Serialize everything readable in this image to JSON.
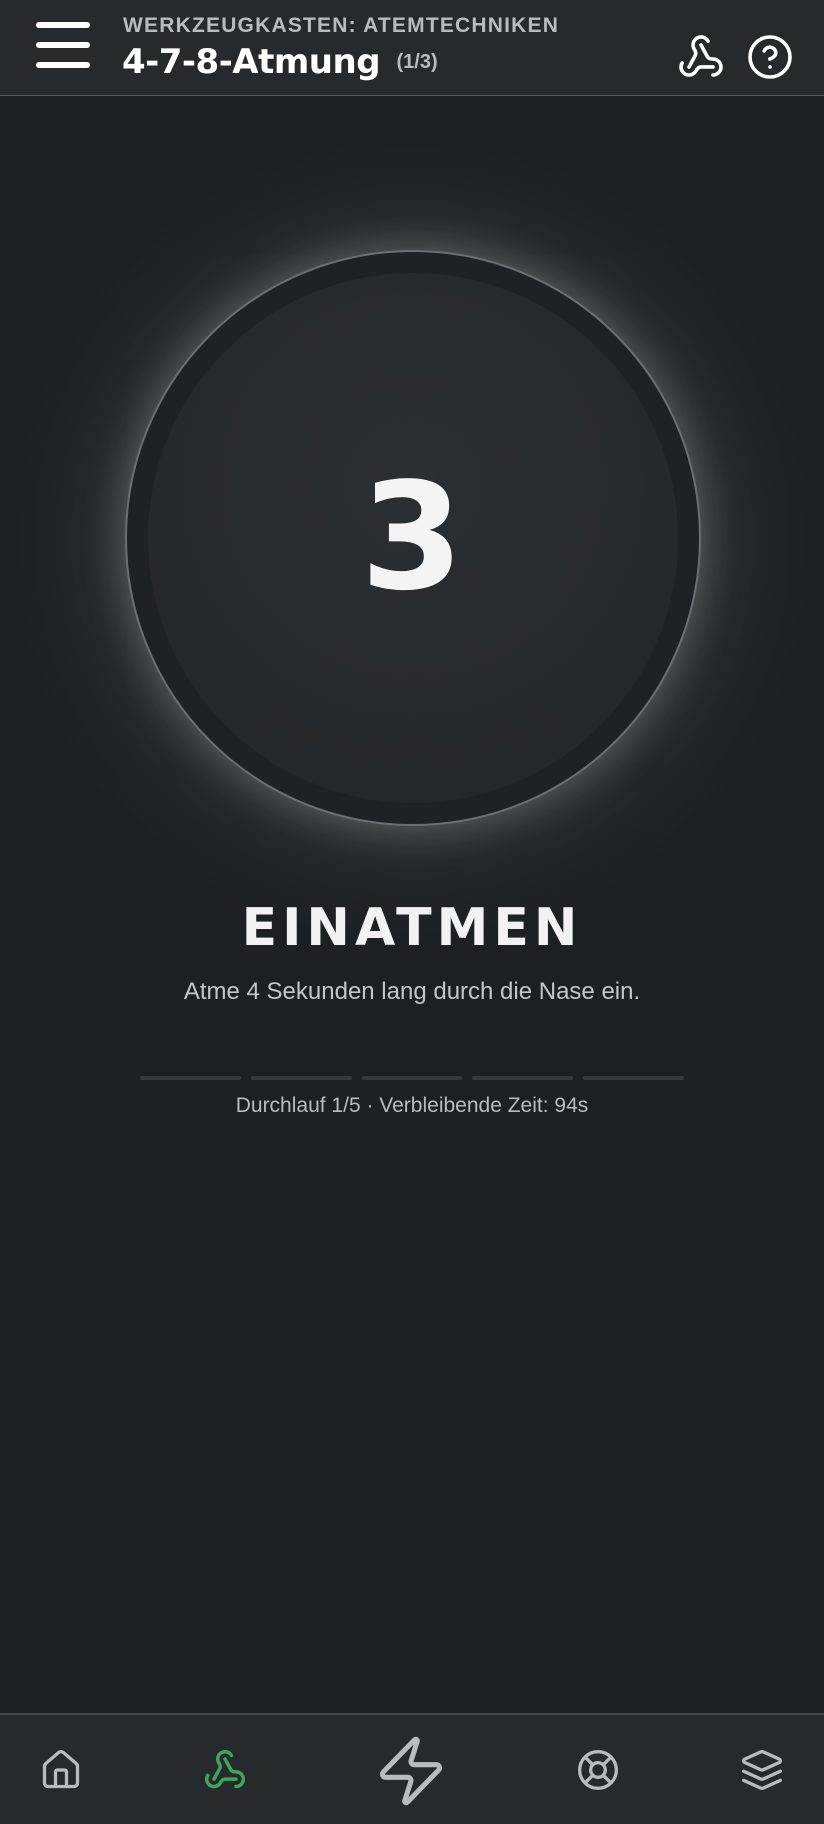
{
  "header": {
    "kicker": "WERKZEUGKASTEN: ATEMTECHNIKEN",
    "title": "4-7-8-Atmung",
    "step": "(1/3)"
  },
  "exercise": {
    "count": "3",
    "phase": "EINATMEN",
    "instruction": "Atme 4 Sekunden lang durch die Nase ein.",
    "cycle_text": "Durchlauf 1/5 · Verbleibende Zeit: 94s",
    "total_cycles": 5,
    "current_cycle": 1
  },
  "colors": {
    "background": "#1d2021",
    "header": "#272a2d",
    "accent_green": "#3fa45c",
    "icon_gray": "#b8bcbf"
  },
  "bottom_nav": {
    "items": [
      {
        "icon": "home-icon",
        "active": false
      },
      {
        "icon": "breathing-icon",
        "active": true
      },
      {
        "icon": "lightning-icon",
        "active": false
      },
      {
        "icon": "lifebuoy-icon",
        "active": false
      },
      {
        "icon": "layers-icon",
        "active": false
      }
    ]
  }
}
